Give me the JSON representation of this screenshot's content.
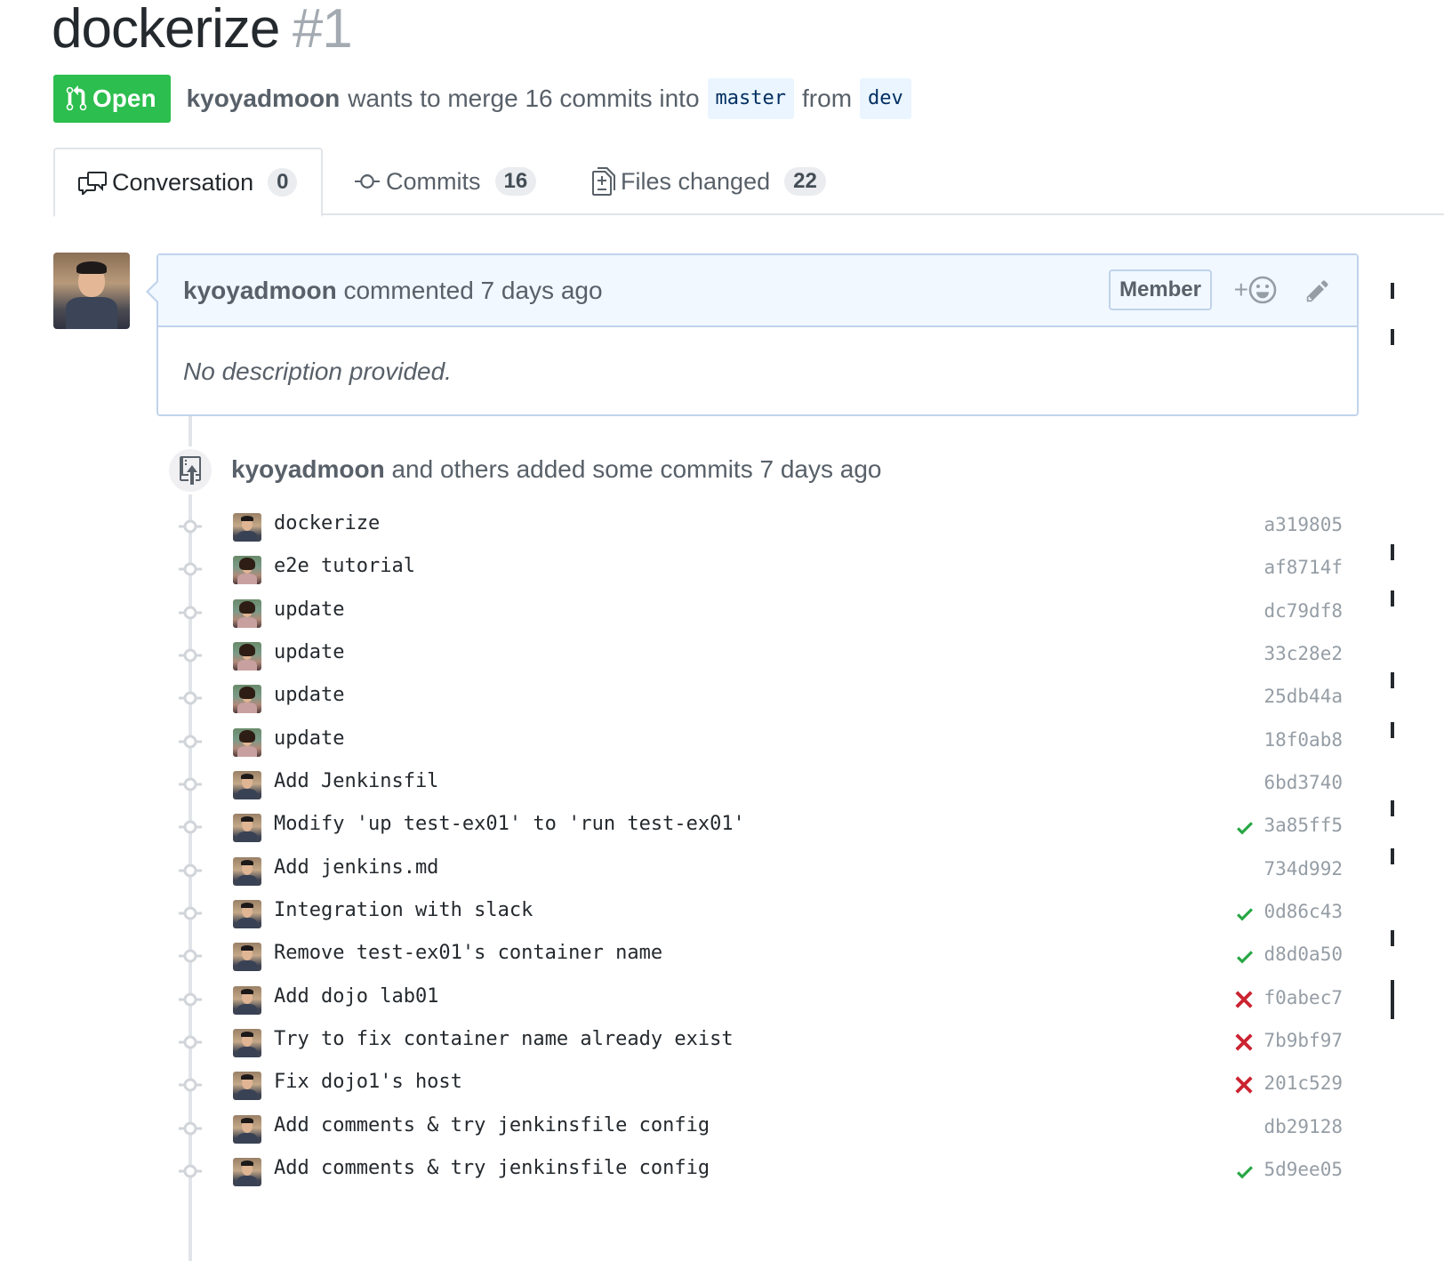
{
  "pr": {
    "title": "dockerize",
    "number": "#1",
    "state": "Open",
    "author": "kyoyadmoon",
    "merge_text": "wants to merge 16 commits into",
    "base_branch": "master",
    "from_text": "from",
    "head_branch": "dev"
  },
  "tabs": [
    {
      "label": "Conversation",
      "count": "0",
      "icon": "comment-discussion-icon"
    },
    {
      "label": "Commits",
      "count": "16",
      "icon": "git-commit-icon"
    },
    {
      "label": "Files changed",
      "count": "22",
      "icon": "file-diff-icon"
    }
  ],
  "comment": {
    "author": "kyoyadmoon",
    "action": "commented 7 days ago",
    "badge": "Member",
    "react_plus": "+",
    "body": "No description provided."
  },
  "commits_event": {
    "author": "kyoyadmoon",
    "text": "and others added some commits 7 days ago"
  },
  "commits": [
    {
      "message": "dockerize",
      "sha": "a319805",
      "status": "none",
      "avatar": "m"
    },
    {
      "message": "e2e tutorial",
      "sha": "af8714f",
      "status": "none",
      "avatar": "f"
    },
    {
      "message": "update",
      "sha": "dc79df8",
      "status": "none",
      "avatar": "f"
    },
    {
      "message": "update",
      "sha": "33c28e2",
      "status": "none",
      "avatar": "f"
    },
    {
      "message": "update",
      "sha": "25db44a",
      "status": "none",
      "avatar": "f"
    },
    {
      "message": "update",
      "sha": "18f0ab8",
      "status": "none",
      "avatar": "f"
    },
    {
      "message": "Add Jenkinsfil",
      "sha": "6bd3740",
      "status": "none",
      "avatar": "m"
    },
    {
      "message": "Modify 'up test-ex01' to 'run test-ex01'",
      "sha": "3a85ff5",
      "status": "success",
      "avatar": "m"
    },
    {
      "message": "Add jenkins.md",
      "sha": "734d992",
      "status": "none",
      "avatar": "m"
    },
    {
      "message": "Integration with slack",
      "sha": "0d86c43",
      "status": "success",
      "avatar": "m"
    },
    {
      "message": "Remove test-ex01's container name",
      "sha": "d8d0a50",
      "status": "success",
      "avatar": "m"
    },
    {
      "message": "Add dojo lab01",
      "sha": "f0abec7",
      "status": "failure",
      "avatar": "m"
    },
    {
      "message": "Try to fix container name already exist",
      "sha": "7b9bf97",
      "status": "failure",
      "avatar": "m"
    },
    {
      "message": "Fix dojo1's host",
      "sha": "201c529",
      "status": "failure",
      "avatar": "m"
    },
    {
      "message": "Add comments & try jenkinsfile config",
      "sha": "db29128",
      "status": "none",
      "avatar": "m"
    },
    {
      "message": "Add comments & try jenkinsfile config",
      "sha": "5d9ee05",
      "status": "success",
      "avatar": "m"
    }
  ],
  "colors": {
    "open_green": "#2cbe4e",
    "success_green": "#28a745",
    "failure_red": "#cb2431",
    "header_blue": "#f1f8ff",
    "branch_blue": "#eaf5ff"
  }
}
